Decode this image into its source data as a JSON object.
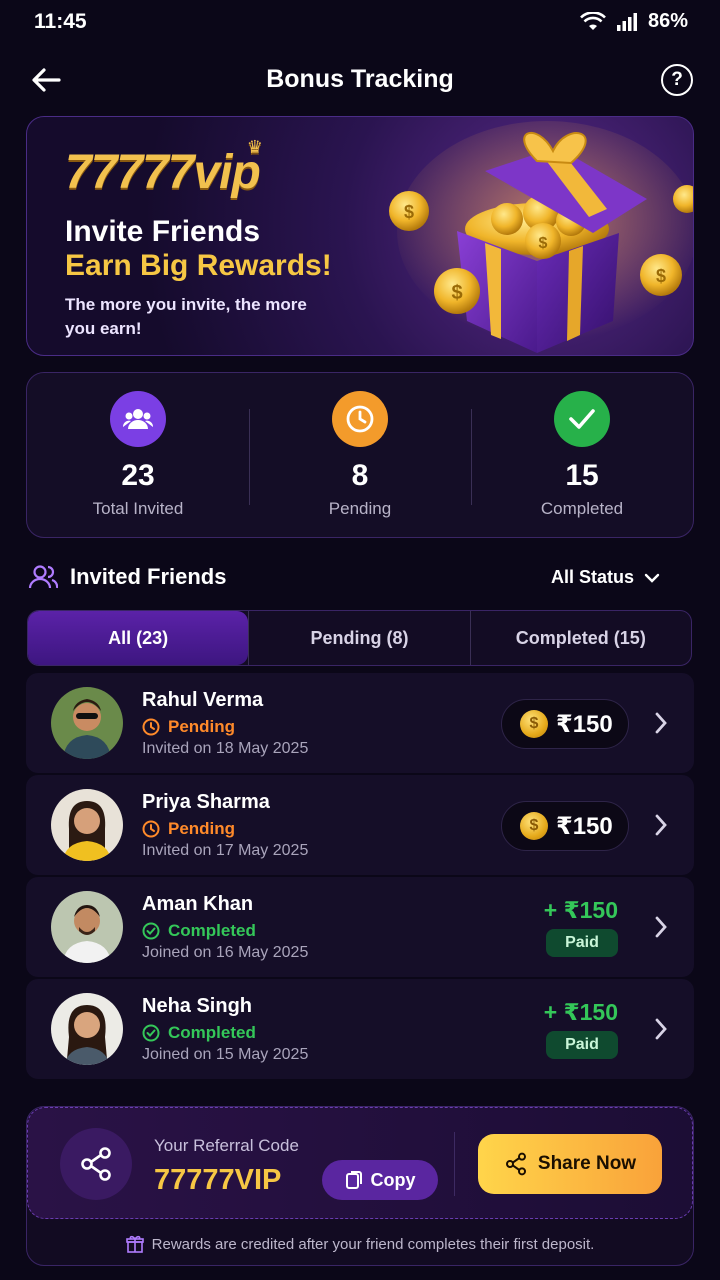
{
  "status_bar": {
    "time": "11:45",
    "battery": "86%"
  },
  "header": {
    "title": "Bonus Tracking",
    "help_glyph": "?"
  },
  "banner": {
    "brand": "77777vip",
    "headline": "Invite Friends",
    "highlight": "Earn Big Rewards!",
    "subtext": "The more you invite, the more you earn!"
  },
  "stats": [
    {
      "value": "23",
      "label": "Total Invited",
      "icon": "users-icon",
      "color": "#7b3fe4"
    },
    {
      "value": "8",
      "label": "Pending",
      "icon": "clock-icon",
      "color": "#f39b2b"
    },
    {
      "value": "15",
      "label": "Completed",
      "icon": "check-icon",
      "color": "#27b14a"
    }
  ],
  "section": {
    "title": "Invited Friends",
    "filter_label": "All Status"
  },
  "tabs": [
    {
      "label": "All (23)",
      "active": true
    },
    {
      "label": "Pending (8)",
      "active": false
    },
    {
      "label": "Completed (15)",
      "active": false
    }
  ],
  "friends": [
    {
      "name": "Rahul Verma",
      "status": "Pending",
      "date": "Invited on 18 May 2025",
      "reward": "₹150",
      "paid_label": ""
    },
    {
      "name": "Priya Sharma",
      "status": "Pending",
      "date": "Invited on 17 May 2025",
      "reward": "₹150",
      "paid_label": ""
    },
    {
      "name": "Aman Khan",
      "status": "Completed",
      "date": "Joined on 16 May 2025",
      "reward": "+ ₹150",
      "paid_label": "Paid"
    },
    {
      "name": "Neha Singh",
      "status": "Completed",
      "date": "Joined on 15 May 2025",
      "reward": "+ ₹150",
      "paid_label": "Paid"
    }
  ],
  "referral": {
    "label": "Your Referral Code",
    "code": "77777VIP",
    "copy_label": "Copy",
    "share_label": "Share Now",
    "note": "Rewards are credited after your friend completes their first deposit."
  }
}
